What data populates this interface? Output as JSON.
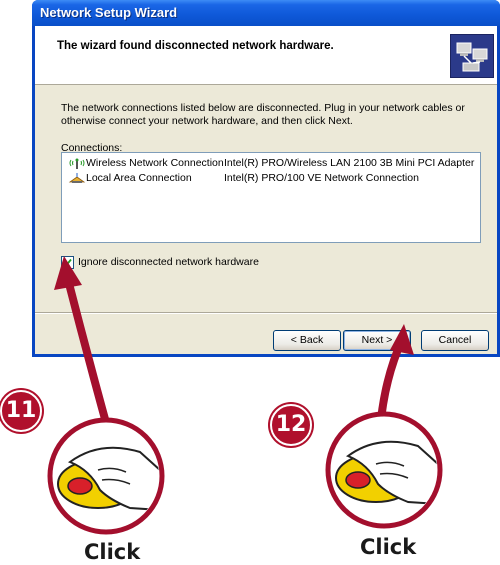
{
  "window": {
    "title": "Network Setup Wizard"
  },
  "header": {
    "title": "The wizard found disconnected network hardware.",
    "icon": "network-setup-icon"
  },
  "main": {
    "instructions": "The network connections listed below are disconnected. Plug in your network cables or otherwise connect your network hardware, and then click Next.",
    "connections_label": "Connections:",
    "connections": [
      {
        "name": "Wireless Network Connection",
        "device": "Intel(R) PRO/Wireless LAN 2100 3B Mini PCI Adapter",
        "icon": "wireless-connection-icon"
      },
      {
        "name": "Local Area Connection",
        "device": "Intel(R) PRO/100 VE Network Connection",
        "icon": "lan-connection-icon"
      }
    ],
    "ignore_checkbox": {
      "label": "Ignore disconnected network hardware",
      "checked": true
    }
  },
  "buttons": {
    "back": "< Back",
    "next": "Next >",
    "cancel": "Cancel"
  },
  "annotations": {
    "step1": {
      "number": "11",
      "label": "Click"
    },
    "step2": {
      "number": "12",
      "label": "Click"
    }
  },
  "colors": {
    "xp_blue": "#0a58d8",
    "dialog_bg": "#ece9d8",
    "annotation_red": "#b0102c"
  }
}
